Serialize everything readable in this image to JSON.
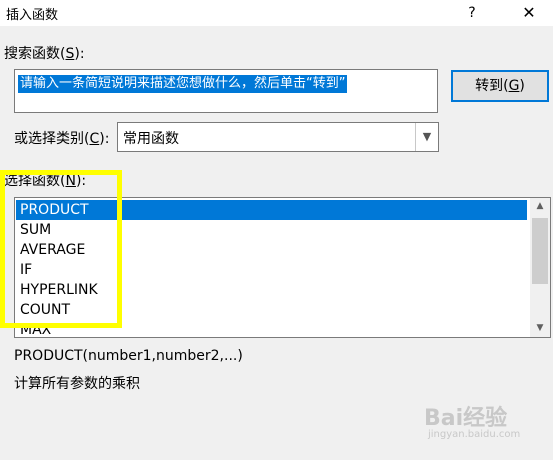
{
  "dialog": {
    "title": "插入函数",
    "help_icon": "?",
    "close_icon": "✕"
  },
  "search": {
    "label_prefix": "搜索函数(",
    "label_key": "S",
    "label_suffix": "):",
    "input_value": "请输入一条简短说明来描述您想做什么，然后单击“转到”",
    "goto_prefix": "转到(",
    "goto_key": "G",
    "goto_suffix": ")"
  },
  "category": {
    "label_prefix": "或选择类别(",
    "label_key": "C",
    "label_suffix": "):",
    "selected": "常用函数"
  },
  "functions": {
    "label_prefix": "选择函数(",
    "label_key": "N",
    "label_suffix": "):",
    "items": [
      "PRODUCT",
      "SUM",
      "AVERAGE",
      "IF",
      "HYPERLINK",
      "COUNT",
      "MAX"
    ],
    "selected_index": 0
  },
  "detail": {
    "signature": "PRODUCT(number1,number2,...)",
    "description": "计算所有参数的乘积"
  },
  "highlight_color": "#ffff00",
  "accent_color": "#0078d7",
  "watermark": {
    "text": "Bai经验",
    "sub": "jingyan.baidu.com"
  }
}
